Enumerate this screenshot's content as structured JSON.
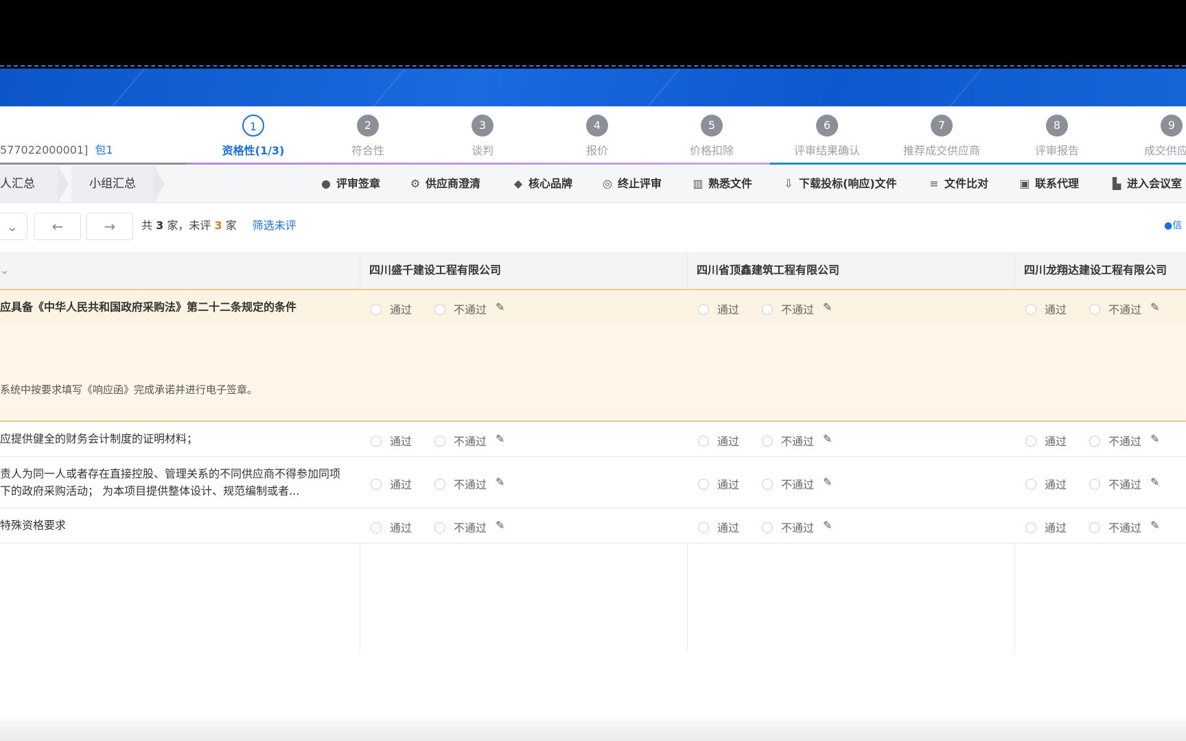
{
  "project": {
    "code": "577022000001]",
    "package": "包1"
  },
  "steps": [
    {
      "num": "1",
      "label": "资格性(1/3)",
      "active": true
    },
    {
      "num": "2",
      "label": "符合性"
    },
    {
      "num": "3",
      "label": "谈判"
    },
    {
      "num": "4",
      "label": "报价"
    },
    {
      "num": "5",
      "label": "价格扣除"
    },
    {
      "num": "6",
      "label": "评审结果确认"
    },
    {
      "num": "7",
      "label": "推荐成交供应商"
    },
    {
      "num": "8",
      "label": "评审报告"
    },
    {
      "num": "9",
      "label": "成交供应商"
    }
  ],
  "crumbs": [
    "人汇总",
    "小组汇总"
  ],
  "toolbar": [
    {
      "label": "评审签章",
      "icon": "seal-icon"
    },
    {
      "label": "供应商澄清",
      "icon": "clarify-icon"
    },
    {
      "label": "核心品牌",
      "icon": "diamond-icon"
    },
    {
      "label": "终止评审",
      "icon": "stop-icon"
    },
    {
      "label": "熟悉文件",
      "icon": "books-icon"
    },
    {
      "label": "下载投标(响应)文件",
      "icon": "download-icon"
    },
    {
      "label": "文件比对",
      "icon": "compare-icon"
    },
    {
      "label": "联系代理",
      "icon": "contact-icon"
    },
    {
      "label": "进入会议室",
      "icon": "meeting-icon"
    }
  ],
  "pager": {
    "prefix": "共",
    "total": "3",
    "mid": "家，未评",
    "pending": "3",
    "suffix": "家",
    "filter": "筛选未评",
    "right_link": "信"
  },
  "suppliers": [
    "四川盛千建设工程有限公司",
    "四川省顶鑫建筑工程有限公司",
    "四川龙翔达建设工程有限公司"
  ],
  "options": {
    "pass": "通过",
    "fail": "不通过"
  },
  "rows": [
    {
      "text": "应具备《中华人民共和国政府采购法》第二十二条规定的条件",
      "bold": true
    },
    {
      "text": "应提供健全的财务会计制度的证明材料；"
    },
    {
      "text": "责人为同一人或者存在直接控股、管理关系的不同供应商不得参加同项下的政府采购活动； 为本项目提供整体设计、规范编制或者..."
    },
    {
      "text": "特殊资格要求"
    }
  ],
  "explanation": "系统中按要求填写《响应函》完成承诺并进行电子签章。",
  "colors": {
    "accent": "#1d6fd6",
    "highlight": "#fdf3e3",
    "pending": "#e07b1f"
  }
}
